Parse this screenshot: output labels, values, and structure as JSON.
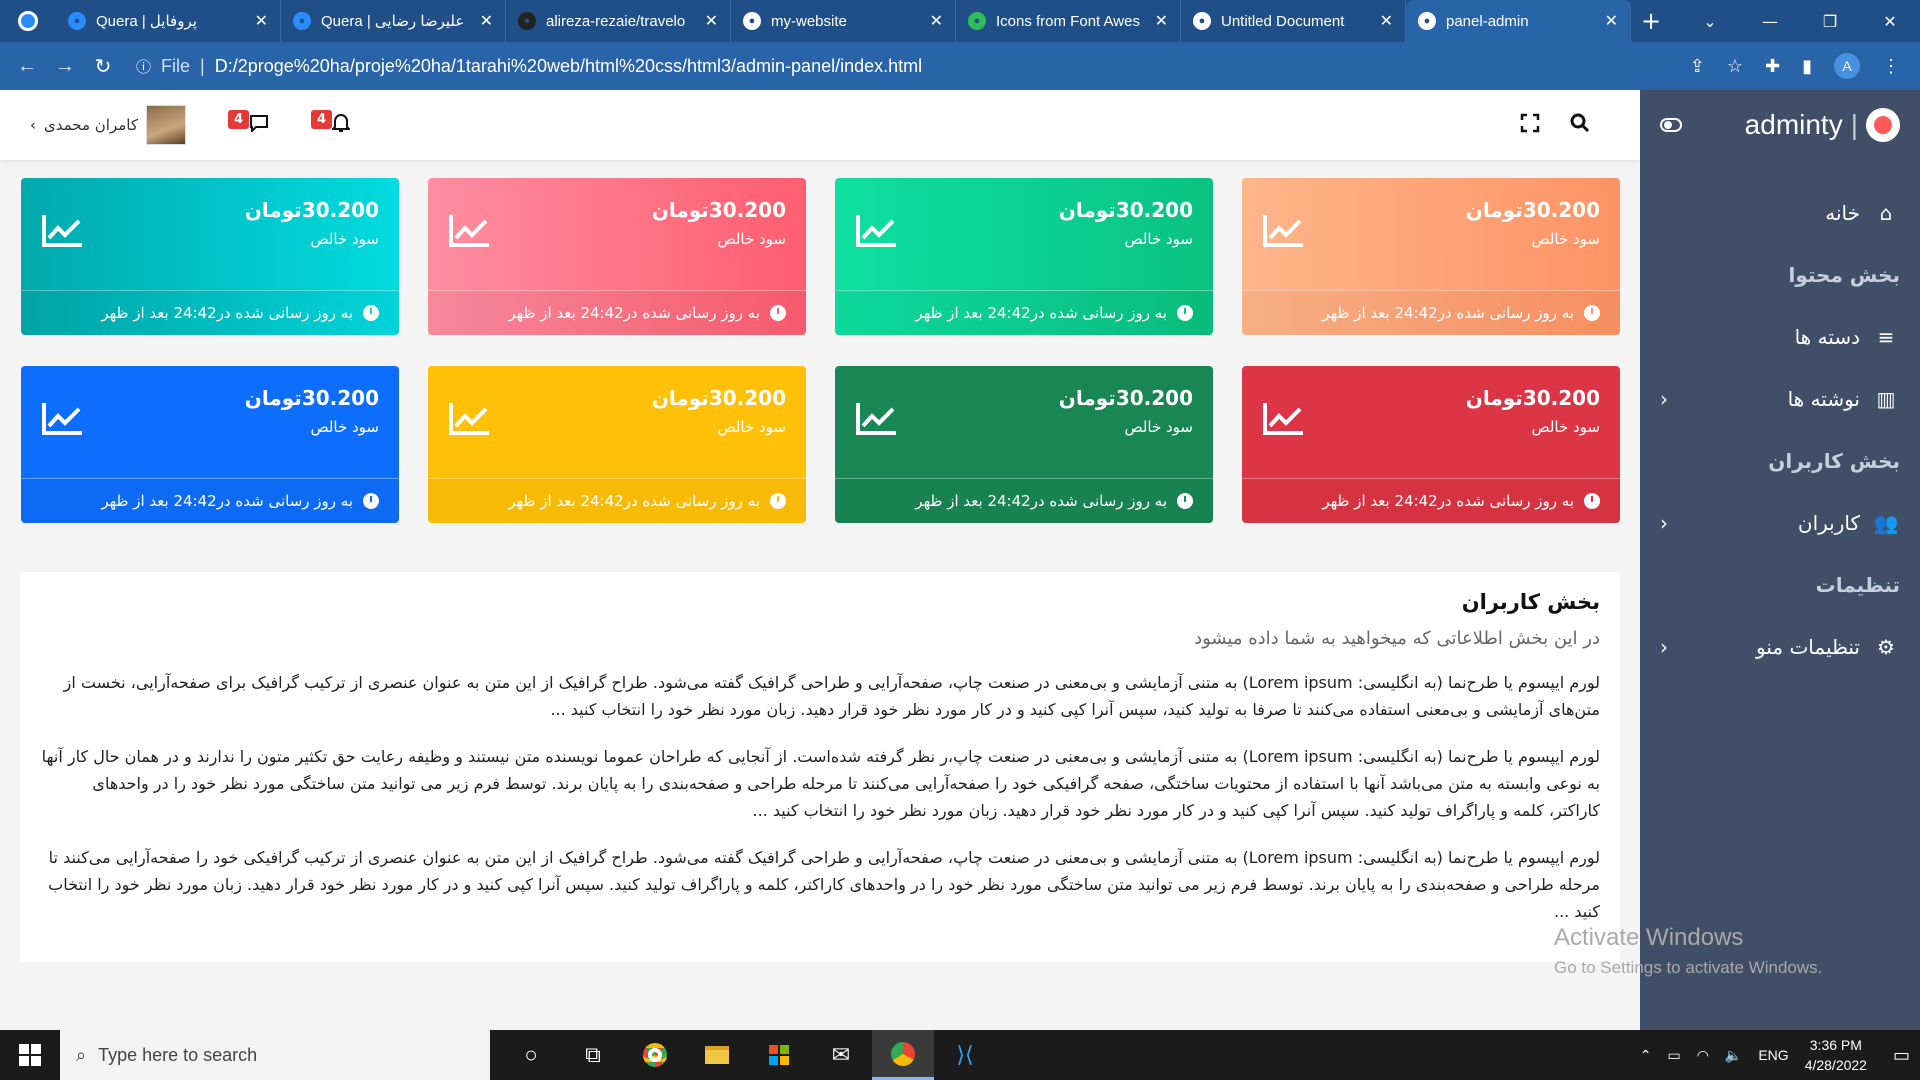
{
  "browser": {
    "tabs": [
      {
        "title": "Quera | پروفایل",
        "fav_color": "#2a8cff"
      },
      {
        "title": "Quera | علیرضا رضایی",
        "fav_color": "#2a8cff"
      },
      {
        "title": "alireza-rezaie/travelo",
        "fav_color": "#222222"
      },
      {
        "title": "my-website",
        "fav_color": "#ffffff"
      },
      {
        "title": "Icons from Font Awes",
        "fav_color": "#2ebd59"
      },
      {
        "title": "Untitled Document",
        "fav_color": "#ffffff"
      },
      {
        "title": "panel-admin",
        "fav_color": "#ffffff"
      }
    ],
    "active_tab": 6,
    "address_prefix": "File",
    "url": "D:/2proge%20ha/proje%20ha/1tarahi%20web/html%20css/html3/admin-panel/index.html",
    "profile_letter": "A"
  },
  "topbar": {
    "user_name": "کامران محمدی",
    "messages_count": "4",
    "notifications_count": "4"
  },
  "sidebar": {
    "brand": "adminty",
    "items": [
      {
        "type": "item",
        "label": "خانه",
        "icon": "home-icon",
        "glyph": "⌂",
        "chevron": false
      },
      {
        "type": "header",
        "label": "بخش محتوا"
      },
      {
        "type": "item",
        "label": "دسته ها",
        "icon": "list-icon",
        "glyph": "≡",
        "chevron": false
      },
      {
        "type": "item",
        "label": "نوشته ها",
        "icon": "chart-bar-icon",
        "glyph": "▥",
        "chevron": true
      },
      {
        "type": "header",
        "label": "بخش کاربران"
      },
      {
        "type": "item",
        "label": "کاربران",
        "icon": "users-icon",
        "glyph": "👥",
        "chevron": true
      },
      {
        "type": "header",
        "label": "تنظیمات"
      },
      {
        "type": "item",
        "label": "تنظیمات منو",
        "icon": "gears-icon",
        "glyph": "⚙",
        "chevron": true
      }
    ]
  },
  "cards": [
    {
      "value": "30.200تومان",
      "label": "سود خالص",
      "footer": "به روز رسانی شده در24:42 بعد از ظهر",
      "grad": [
        "#ffb58a",
        "#fe9365"
      ]
    },
    {
      "value": "30.200تومان",
      "label": "سود خالص",
      "footer": "به روز رسانی شده در24:42 بعد از ظهر",
      "grad": [
        "#0ee0a0",
        "#0ac282"
      ]
    },
    {
      "value": "30.200تومان",
      "label": "سود خالص",
      "footer": "به روز رسانی شده در24:42 بعد از ظهر",
      "grad": [
        "#fe8ea0",
        "#fe5d70"
      ]
    },
    {
      "value": "30.200تومان",
      "label": "سود خالص",
      "footer": "به روز رسانی شده در24:42 بعد از ظهر",
      "grad": [
        "#01a9ac",
        "#01dbdf"
      ]
    },
    {
      "value": "30.200تومان",
      "label": "سود خالص",
      "footer": "به روز رسانی شده در24:42 بعد از ظهر",
      "grad": [
        "#dc3545",
        "#dc3545"
      ]
    },
    {
      "value": "30.200تومان",
      "label": "سود خالص",
      "footer": "به روز رسانی شده در24:42 بعد از ظهر",
      "grad": [
        "#198754",
        "#198754"
      ]
    },
    {
      "value": "30.200تومان",
      "label": "سود خالص",
      "footer": "به روز رسانی شده در24:42 بعد از ظهر",
      "grad": [
        "#ffc107",
        "#ffc107"
      ]
    },
    {
      "value": "30.200تومان",
      "label": "سود خالص",
      "footer": "به روز رسانی شده در24:42 بعد از ظهر",
      "grad": [
        "#0d6efd",
        "#0d6efd"
      ]
    }
  ],
  "panel": {
    "title": "بخش کاربران",
    "lead": "در این بخش اطلاعاتی که میخواهید به شما داده میشود",
    "paragraphs": [
      "لورم ایپسوم یا طرح‌نما (به انگلیسی: Lorem ipsum) به متنی آزمایشی و بی‌معنی در صنعت چاپ، صفحه‌آرایی و طراحی گرافیک گفته می‌شود. طراح گرافیک از این متن به عنوان عنصری از ترکیب گرافیک برای صفحه‌آرایی، نخست از متن‌های آزمایشی و بی‌معنی استفاده می‌کنند تا صرفا به تولید کنید، سپس آنرا کپی کنید و در کار مورد نظر خود قرار دهید. زبان مورد نظر خود را انتخاب کنید ...",
      "لورم ایپسوم یا طرح‌نما (به انگلیسی: Lorem ipsum) به متنی آزمایشی و بی‌معنی در صنعت چاپ،ر نظر گرفته شده‌است. از آنجایی که طراحان عموما نویسنده متن نیستند و وظیفه رعایت حق تکثیر متون را ندارند و در همان حال کار آنها به نوعی وابسته به متن می‌باشد آنها با استفاده از محتویات ساختگی، صفحه گرافیکی خود را صفحه‌آرایی می‌کنند تا مرحله طراحی و صفحه‌بندی را به پایان برند. توسط فرم زیر می توانید متن ساختگی مورد نظر خود را در واحدهای کاراکتر، کلمه و پاراگراف تولید کنید. سپس آنرا کپی کنید و در کار مورد نظر خود قرار دهید. زبان مورد نظر خود را انتخاب کنید ...",
      "لورم ایپسوم یا طرح‌نما (به انگلیسی: Lorem ipsum) به متنی آزمایشی و بی‌معنی در صنعت چاپ، صفحه‌آرایی و طراحی گرافیک گفته می‌شود. طراح گرافیک از این متن به عنوان عنصری از ترکیب گرافیکی خود را صفحه‌آرایی می‌کنند تا مرحله طراحی و صفحه‌بندی را به پایان برند. توسط فرم زیر می توانید متن ساختگی مورد نظر خود را در واحدهای کاراکتر، کلمه و پاراگراف تولید کنید. سپس آنرا کپی کنید و در کار مورد نظر خود قرار دهید. زبان مورد نظر خود را انتخاب کنید ..."
    ]
  },
  "watermark": {
    "line1": "Activate Windows",
    "line2": "Go to Settings to activate Windows."
  },
  "taskbar": {
    "search_placeholder": "Type here to search",
    "lang": "ENG",
    "time": "3:36 PM",
    "date": "4/28/2022"
  }
}
